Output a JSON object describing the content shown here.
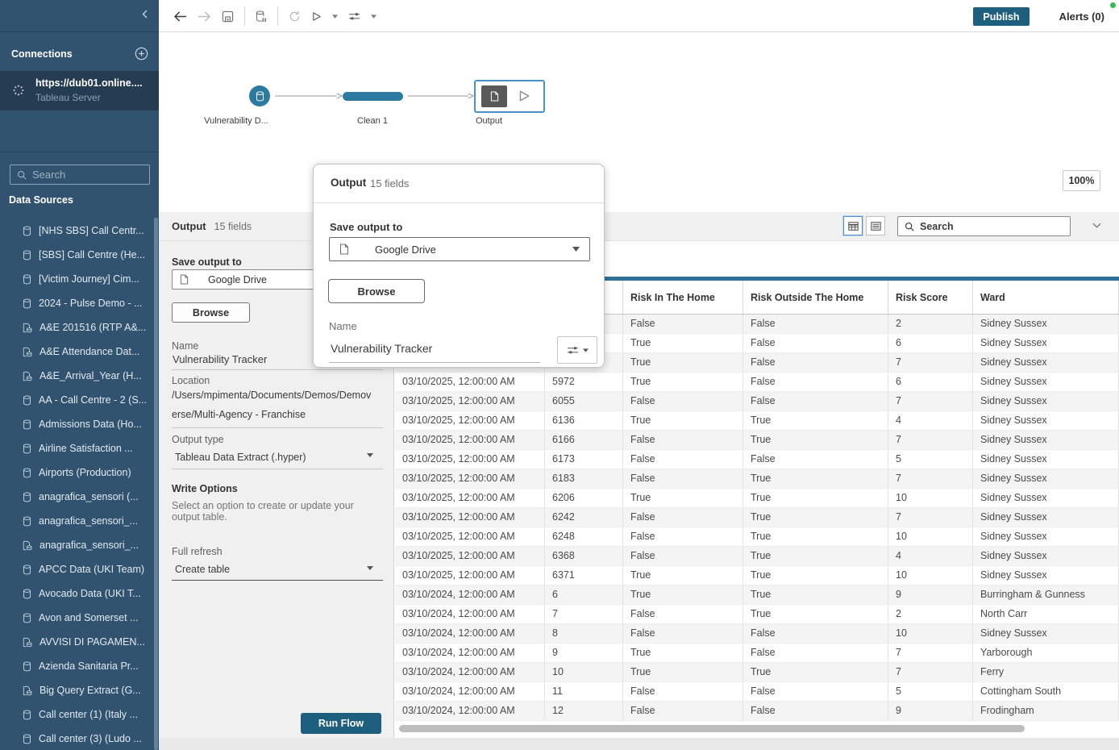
{
  "toolbar": {
    "publish_label": "Publish",
    "alerts_label": "Alerts (0)",
    "icons": [
      "back-icon",
      "forward-icon",
      "save-icon",
      "pause-data-updates-icon",
      "refresh-icon",
      "run-flow-icon",
      "settings-sliders-icon"
    ]
  },
  "sidebar": {
    "connections_title": "Connections",
    "connection": {
      "url": "https://dub01.online....",
      "type": "Tableau Server",
      "icon": "server-connection-icon"
    },
    "search_placeholder": "Search",
    "data_sources": {
      "title": "Data Sources",
      "items": [
        {
          "label": "[NHS SBS] Call Centr...",
          "icon": "database-icon"
        },
        {
          "label": "[SBS] Call Centre (He...",
          "icon": "database-icon"
        },
        {
          "label": "[Victim Journey] Cim...",
          "icon": "database-icon"
        },
        {
          "label": "2024 - Pulse Demo - ...",
          "icon": "database-icon"
        },
        {
          "label": "A&E 201516 (RTP A&...",
          "icon": "published-datasource-icon"
        },
        {
          "label": "A&E Attendance Dat...",
          "icon": "published-datasource-icon"
        },
        {
          "label": "A&E_Arrival_Year (H...",
          "icon": "published-datasource-icon"
        },
        {
          "label": "AA - Call Centre - 2 (S...",
          "icon": "database-icon"
        },
        {
          "label": "Admissions Data (Ho...",
          "icon": "database-icon"
        },
        {
          "label": "Airline Satisfaction ...",
          "icon": "database-icon"
        },
        {
          "label": "Airports (Production)",
          "icon": "database-icon"
        },
        {
          "label": "anagrafica_sensori (...",
          "icon": "database-icon"
        },
        {
          "label": "anagrafica_sensori_...",
          "icon": "database-icon"
        },
        {
          "label": "anagrafica_sensori_...",
          "icon": "published-datasource-icon"
        },
        {
          "label": "APCC Data (UKI Team)",
          "icon": "database-icon"
        },
        {
          "label": "Avocado Data (UKI T...",
          "icon": "database-icon"
        },
        {
          "label": "Avon and Somerset ...",
          "icon": "database-icon"
        },
        {
          "label": "AVVISI DI PAGAMEN...",
          "icon": "published-datasource-icon"
        },
        {
          "label": "Azienda Sanitaria Pr...",
          "icon": "database-icon"
        },
        {
          "label": "Big Query Extract (G...",
          "icon": "published-datasource-icon"
        },
        {
          "label": "Call center (1) (Italy ...",
          "icon": "database-icon"
        },
        {
          "label": "Call center (3) (Ludo ...",
          "icon": "database-icon"
        }
      ]
    }
  },
  "flow": {
    "nodes": [
      {
        "label": "Vulnerability D...",
        "type": "input",
        "icon": "database-icon"
      },
      {
        "label": "Clean 1",
        "type": "clean"
      },
      {
        "label": "Output",
        "type": "output",
        "icon": "file-icon"
      }
    ],
    "zoom_level": "100%"
  },
  "output_pane": {
    "title": "Output",
    "fields_count": "15 fields",
    "search_placeholder": "Search",
    "save_output_to_label": "Save output to",
    "destination": "Google Drive",
    "browse_label": "Browse",
    "name_label": "Name",
    "name_value": "Vulnerability Tracker",
    "location_label": "Location",
    "location_line1": "/Users/mpimenta/Documents/Demos/Demov",
    "location_line2": "erse/Multi-Agency - Franchise",
    "output_type_label": "Output type",
    "output_type_value": "Tableau Data Extract (.hyper)",
    "write_options_label": "Write Options",
    "write_options_desc1": "Select an option to create or update your",
    "write_options_desc2": "output table.",
    "full_refresh_label": "Full refresh",
    "write_option_value": "Create table",
    "run_flow_label": "Run Flow"
  },
  "popup": {
    "title": "Output",
    "fields_count": "15 fields",
    "save_output_to_label": "Save output to",
    "destination": "Google Drive",
    "browse_label": "Browse",
    "name_label": "Name",
    "name_value": "Vulnerability Tracker"
  },
  "grid": {
    "columns": [
      "",
      "",
      "Risk In The Home",
      "Risk Outside The Home",
      "Risk Score",
      "Ward"
    ],
    "rows": [
      [
        "",
        "",
        "False",
        "False",
        "2",
        "Sidney Sussex"
      ],
      [
        "",
        "",
        "True",
        "False",
        "6",
        "Sidney Sussex"
      ],
      [
        "",
        "",
        "True",
        "False",
        "7",
        "Sidney Sussex"
      ],
      [
        "03/10/2025, 12:00:00 AM",
        "5972",
        "True",
        "False",
        "6",
        "Sidney Sussex"
      ],
      [
        "03/10/2025, 12:00:00 AM",
        "6055",
        "False",
        "False",
        "7",
        "Sidney Sussex"
      ],
      [
        "03/10/2025, 12:00:00 AM",
        "6136",
        "True",
        "True",
        "4",
        "Sidney Sussex"
      ],
      [
        "03/10/2025, 12:00:00 AM",
        "6166",
        "False",
        "True",
        "7",
        "Sidney Sussex"
      ],
      [
        "03/10/2025, 12:00:00 AM",
        "6173",
        "False",
        "False",
        "5",
        "Sidney Sussex"
      ],
      [
        "03/10/2025, 12:00:00 AM",
        "6183",
        "False",
        "True",
        "7",
        "Sidney Sussex"
      ],
      [
        "03/10/2025, 12:00:00 AM",
        "6206",
        "True",
        "True",
        "10",
        "Sidney Sussex"
      ],
      [
        "03/10/2025, 12:00:00 AM",
        "6242",
        "False",
        "True",
        "7",
        "Sidney Sussex"
      ],
      [
        "03/10/2025, 12:00:00 AM",
        "6248",
        "False",
        "True",
        "10",
        "Sidney Sussex"
      ],
      [
        "03/10/2025, 12:00:00 AM",
        "6368",
        "False",
        "True",
        "4",
        "Sidney Sussex"
      ],
      [
        "03/10/2025, 12:00:00 AM",
        "6371",
        "True",
        "True",
        "10",
        "Sidney Sussex"
      ],
      [
        "03/10/2024, 12:00:00 AM",
        "6",
        "True",
        "True",
        "9",
        "Burringham & Gunness"
      ],
      [
        "03/10/2024, 12:00:00 AM",
        "7",
        "False",
        "True",
        "2",
        "North Carr"
      ],
      [
        "03/10/2024, 12:00:00 AM",
        "8",
        "False",
        "False",
        "10",
        "Sidney Sussex"
      ],
      [
        "03/10/2024, 12:00:00 AM",
        "9",
        "True",
        "False",
        "7",
        "Yarborough"
      ],
      [
        "03/10/2024, 12:00:00 AM",
        "10",
        "True",
        "True",
        "7",
        "Ferry"
      ],
      [
        "03/10/2024, 12:00:00 AM",
        "11",
        "False",
        "False",
        "5",
        "Cottingham South"
      ],
      [
        "03/10/2024, 12:00:00 AM",
        "12",
        "False",
        "False",
        "9",
        "Frodingham"
      ]
    ]
  },
  "colors": {
    "sidebar_bg": "#32536F",
    "sidebar_selected": "#263C52",
    "accent_blue": "#2D7AA1",
    "node_selection_blue": "#4C90C8",
    "button_dark_blue": "#1F5F7E",
    "grid_top_bar": "#2E7299",
    "status_green": "#2FBE4F"
  }
}
